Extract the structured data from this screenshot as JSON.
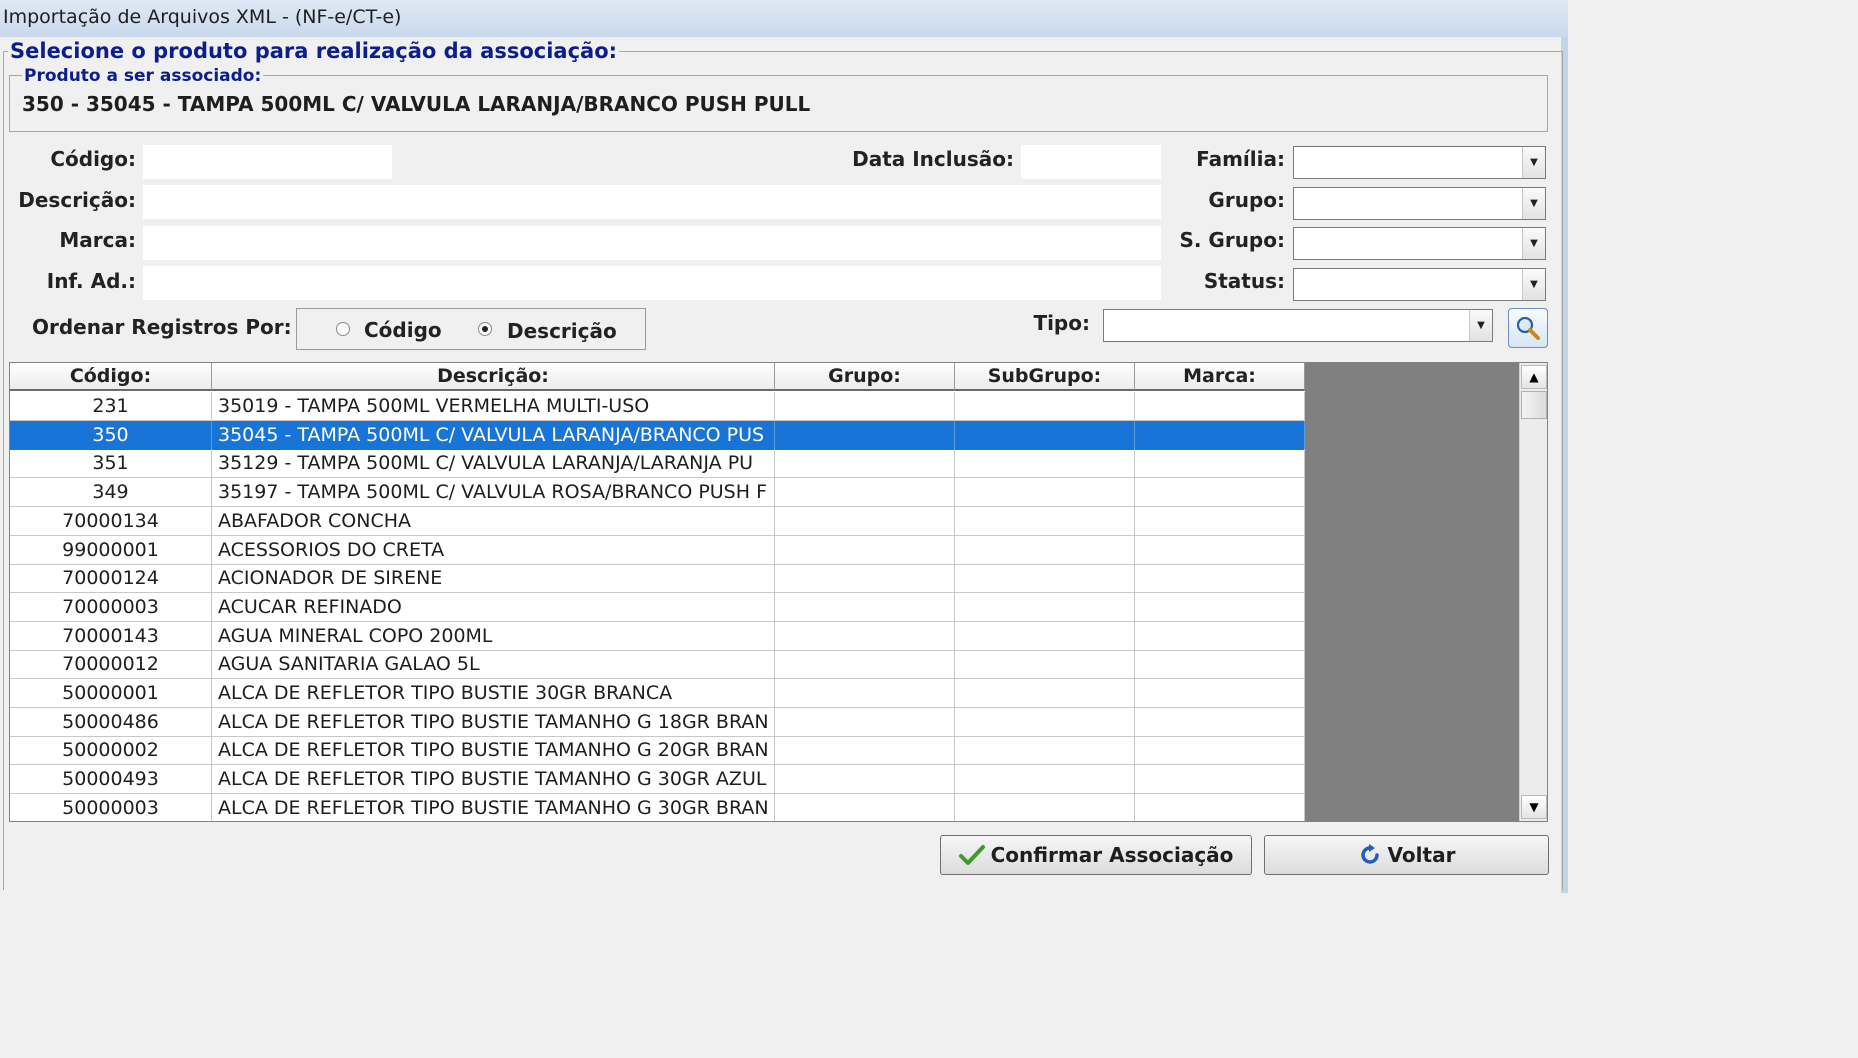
{
  "window": {
    "title": "Importação de Arquivos XML - (NF-e/CT-e)"
  },
  "select_group": {
    "legend": "Selecione o produto para realização da associação:"
  },
  "product_group": {
    "legend": "Produto a ser associado:",
    "value": "350 - 35045 - TAMPA 500ML C/ VALVULA LARANJA/BRANCO PUSH PULL"
  },
  "filters": {
    "codigo_label": "Código:",
    "codigo_value": "",
    "data_inclusao_label": "Data Inclusão:",
    "data_inclusao_value": "",
    "descricao_label": "Descrição:",
    "descricao_value": "",
    "marca_label": "Marca:",
    "marca_value": "",
    "inf_ad_label": "Inf. Ad.:",
    "inf_ad_value": "",
    "familia_label": "Família:",
    "familia_value": "",
    "grupo_label": "Grupo:",
    "grupo_value": "",
    "sgrupo_label": "S. Grupo:",
    "sgrupo_value": "",
    "status_label": "Status:",
    "status_value": "",
    "tipo_label": "Tipo:",
    "tipo_value": ""
  },
  "order": {
    "label": "Ordenar Registros Por:",
    "option_codigo": "Código",
    "option_descricao": "Descrição",
    "selected": "Descrição"
  },
  "grid": {
    "columns": [
      "Código:",
      "Descrição:",
      "Grupo:",
      "SubGrupo:",
      "Marca:"
    ],
    "selected_index": 1,
    "rows": [
      {
        "codigo": "231",
        "descricao": "35019 - TAMPA 500ML VERMELHA MULTI-USO",
        "grupo": "",
        "subgrupo": "",
        "marca": ""
      },
      {
        "codigo": "350",
        "descricao": "35045 - TAMPA 500ML C/ VALVULA LARANJA/BRANCO PUS",
        "grupo": "",
        "subgrupo": "",
        "marca": ""
      },
      {
        "codigo": "351",
        "descricao": "35129 - TAMPA 500ML C/ VALVULA LARANJA/LARANJA PU",
        "grupo": "",
        "subgrupo": "",
        "marca": ""
      },
      {
        "codigo": "349",
        "descricao": "35197 - TAMPA 500ML C/ VALVULA ROSA/BRANCO PUSH F",
        "grupo": "",
        "subgrupo": "",
        "marca": ""
      },
      {
        "codigo": "70000134",
        "descricao": "ABAFADOR CONCHA",
        "grupo": "",
        "subgrupo": "",
        "marca": ""
      },
      {
        "codigo": "99000001",
        "descricao": "ACESSORIOS DO CRETA",
        "grupo": "",
        "subgrupo": "",
        "marca": ""
      },
      {
        "codigo": "70000124",
        "descricao": "ACIONADOR DE SIRENE",
        "grupo": "",
        "subgrupo": "",
        "marca": ""
      },
      {
        "codigo": "70000003",
        "descricao": "ACUCAR REFINADO",
        "grupo": "",
        "subgrupo": "",
        "marca": ""
      },
      {
        "codigo": "70000143",
        "descricao": "AGUA MINERAL COPO 200ML",
        "grupo": "",
        "subgrupo": "",
        "marca": ""
      },
      {
        "codigo": "70000012",
        "descricao": "AGUA SANITARIA GALAO 5L",
        "grupo": "",
        "subgrupo": "",
        "marca": ""
      },
      {
        "codigo": "50000001",
        "descricao": "ALCA DE REFLETOR TIPO BUSTIE 30GR BRANCA",
        "grupo": "",
        "subgrupo": "",
        "marca": ""
      },
      {
        "codigo": "50000486",
        "descricao": "ALCA DE REFLETOR TIPO BUSTIE TAMANHO G 18GR BRAN",
        "grupo": "",
        "subgrupo": "",
        "marca": ""
      },
      {
        "codigo": "50000002",
        "descricao": "ALCA DE REFLETOR TIPO BUSTIE TAMANHO G 20GR BRAN",
        "grupo": "",
        "subgrupo": "",
        "marca": ""
      },
      {
        "codigo": "50000493",
        "descricao": "ALCA DE REFLETOR TIPO BUSTIE TAMANHO G 30GR AZUL",
        "grupo": "",
        "subgrupo": "",
        "marca": ""
      },
      {
        "codigo": "50000003",
        "descricao": "ALCA DE REFLETOR TIPO BUSTIE TAMANHO G 30GR BRAN",
        "grupo": "",
        "subgrupo": "",
        "marca": ""
      }
    ]
  },
  "buttons": {
    "confirm": "Confirmar Associação",
    "back": "Voltar"
  },
  "icons": {
    "search": "search-icon",
    "confirm": "checkmark-icon",
    "back": "refresh-arrow-icon"
  },
  "colors": {
    "selection": "#1874d6",
    "legend_text": "#0b1e8a",
    "grid_empty": "#808080"
  }
}
